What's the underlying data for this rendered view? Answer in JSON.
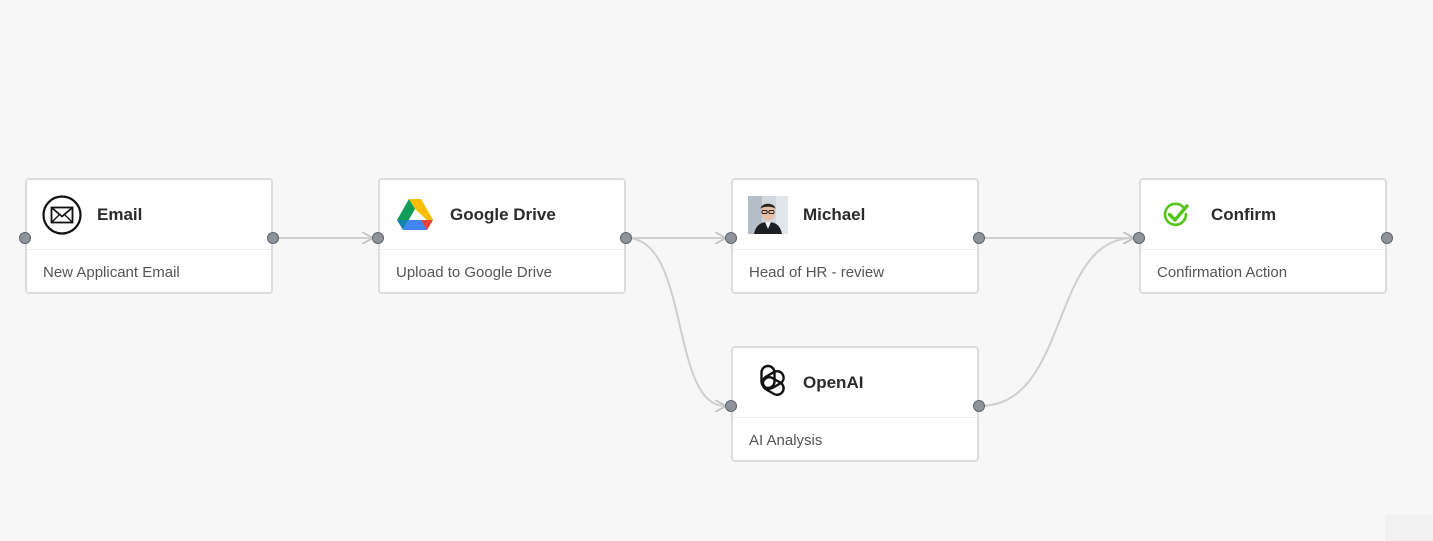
{
  "nodes": [
    {
      "id": "email",
      "title": "Email",
      "subtitle": "New Applicant Email",
      "icon": "envelope-icon"
    },
    {
      "id": "gdrive",
      "title": "Google Drive",
      "subtitle": "Upload to Google Drive",
      "icon": "google-drive-icon"
    },
    {
      "id": "michael",
      "title": "Michael",
      "subtitle": "Head of HR - review",
      "icon": "person-avatar"
    },
    {
      "id": "openai",
      "title": "OpenAI",
      "subtitle": "AI Analysis",
      "icon": "openai-icon"
    },
    {
      "id": "confirm",
      "title": "Confirm",
      "subtitle": "Confirmation Action",
      "icon": "checkmark-icon"
    }
  ],
  "edges": [
    {
      "from": "email",
      "to": "gdrive"
    },
    {
      "from": "gdrive",
      "to": "michael"
    },
    {
      "from": "gdrive",
      "to": "openai"
    },
    {
      "from": "michael",
      "to": "confirm"
    },
    {
      "from": "openai",
      "to": "confirm"
    }
  ],
  "colors": {
    "background": "#f7f7f7",
    "edge": "#cfcfcf",
    "port": "#8e949c",
    "check": "#52c41a"
  }
}
